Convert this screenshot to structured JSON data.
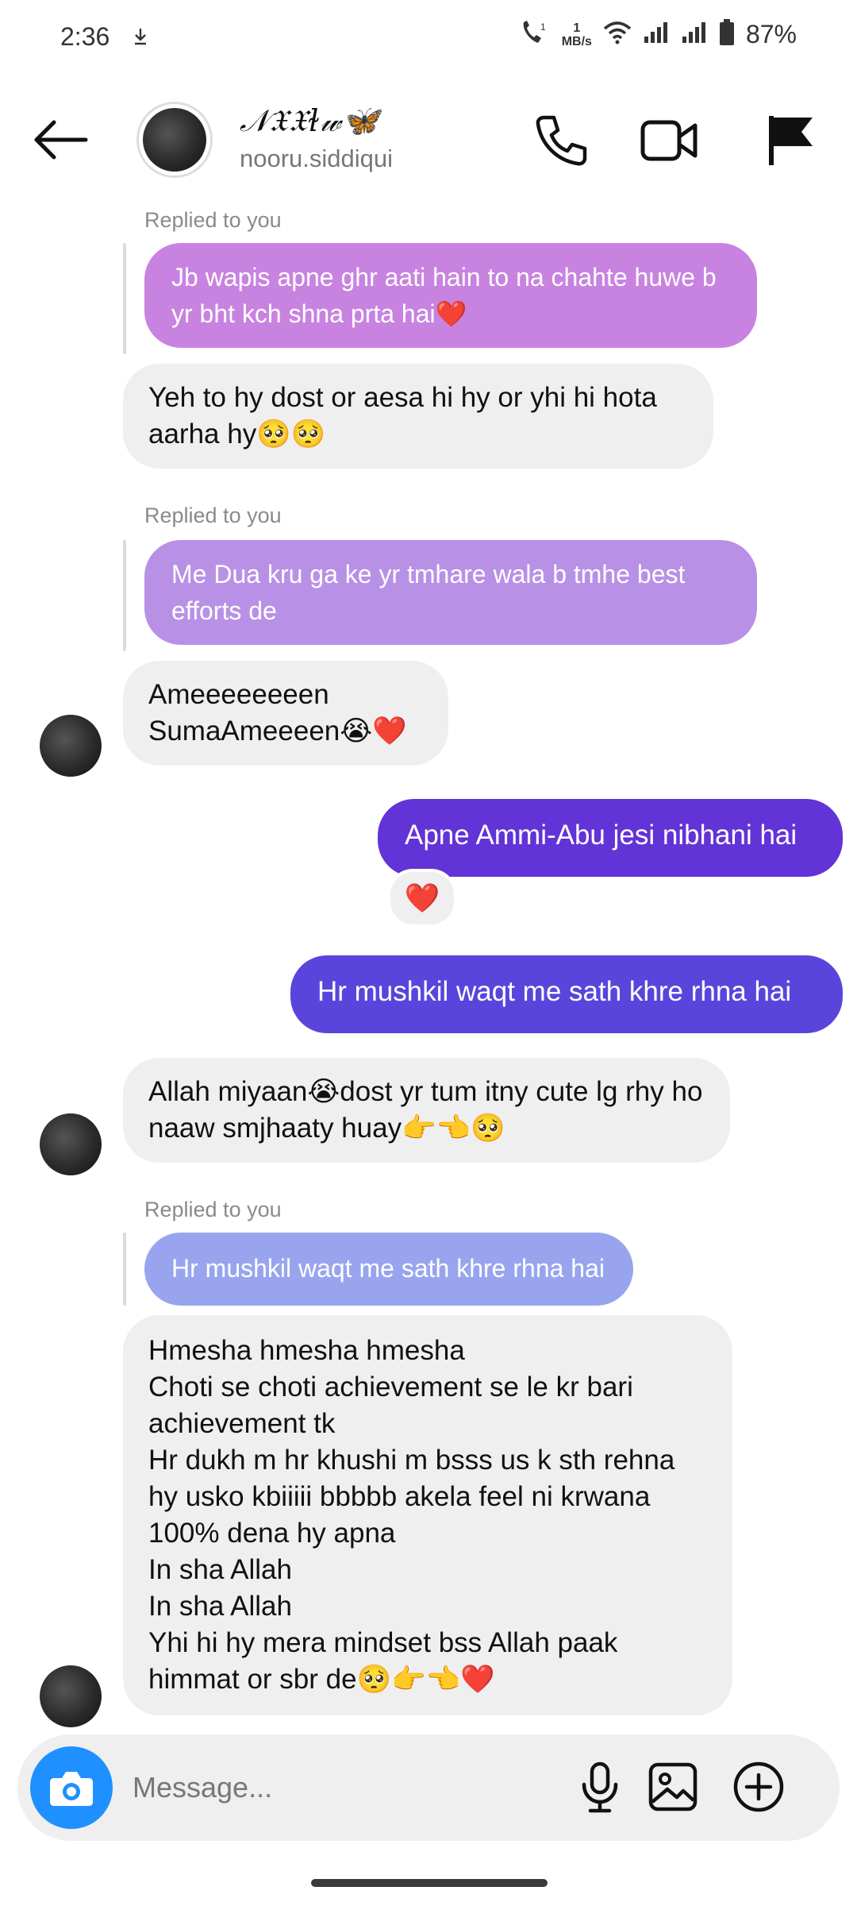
{
  "status_bar": {
    "time": "2:36",
    "download_icon": "download-arrow-icon",
    "net_speed_value": "1",
    "net_speed_unit": "MB/s",
    "battery": "87%"
  },
  "header": {
    "display_name": "𝒩𝔛𝔛ɫ𝓌🦋",
    "username": "nooru.siddiqui",
    "icons": [
      "back-arrow-icon",
      "phone-icon",
      "video-icon",
      "flag-icon"
    ]
  },
  "messages": [
    {
      "type": "reply_label",
      "text": "Replied to you"
    },
    {
      "type": "quoted",
      "text": "Jb wapis apne ghr aati hain to na chahte huwe b yr bht kch shna prta hai❤️"
    },
    {
      "type": "incoming",
      "text": "Yeh to hy dost or aesa hi hy or yhi hi hota aarha hy🥺🥺"
    },
    {
      "type": "reply_label",
      "text": "Replied to you"
    },
    {
      "type": "quoted",
      "text": "Me Dua kru ga ke yr tmhare wala b tmhe best efforts de"
    },
    {
      "type": "incoming",
      "line1": "Ameeeeeeeen",
      "line2": "SumaAmeeeen😭❤️"
    },
    {
      "type": "outgoing",
      "text": "Apne Ammi-Abu jesi nibhani hai",
      "reaction": "❤️"
    },
    {
      "type": "outgoing",
      "text": "Hr mushkil waqt me sath khre rhna hai"
    },
    {
      "type": "incoming",
      "text": "Allah miyaan😭dost yr tum itny cute lg rhy ho naaw smjhaaty huay👉👈🥺"
    },
    {
      "type": "reply_label",
      "text": "Replied to you"
    },
    {
      "type": "quoted",
      "text": "Hr mushkil waqt me sath khre rhna hai"
    },
    {
      "type": "incoming",
      "lines": [
        "Hmesha hmesha hmesha",
        "Choti se choti achievement se le kr bari achievement tk",
        "Hr dukh m hr khushi m bsss us k sth rehna hy usko kbiiiii bbbbb akela feel ni krwana",
        "100% dena hy apna",
        "In sha Allah",
        "In sha Allah",
        "Yhi hi hy mera mindset bss Allah paak himmat or sbr de🥺👉👈❤️"
      ]
    }
  ],
  "composer": {
    "placeholder": "Message...",
    "icons": [
      "camera-icon",
      "microphone-icon",
      "gallery-icon",
      "add-icon"
    ]
  },
  "colors": {
    "quote_1": "#c883e0",
    "quote_2": "#b891e6",
    "outgoing_1": "#6233d6",
    "outgoing_2": "#5a45dc",
    "quote_3": "#98a5ee",
    "incoming": "#efefef",
    "camera_button": "#1e90ff"
  }
}
